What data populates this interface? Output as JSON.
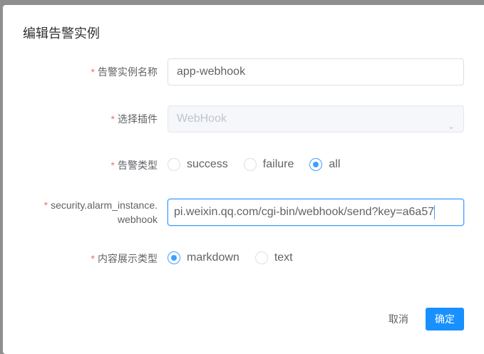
{
  "dialog": {
    "title": "编辑告警实例"
  },
  "form": {
    "required_mark": "*",
    "name": {
      "label": "告警实例名称",
      "value": "app-webhook"
    },
    "plugin": {
      "label": "选择插件",
      "value": "WebHook"
    },
    "alert_type": {
      "label": "告警类型",
      "options": [
        "success",
        "failure",
        "all"
      ],
      "selected": "all"
    },
    "webhook": {
      "label_line1": "security.alarm_instance.",
      "label_line2": "webhook",
      "value": "pi.weixin.qq.com/cgi-bin/webhook/send?key=a6a57"
    },
    "content_type": {
      "label": "内容展示类型",
      "options": [
        "markdown",
        "text"
      ],
      "selected": "markdown"
    }
  },
  "footer": {
    "cancel": "取消",
    "confirm": "确定"
  },
  "colors": {
    "primary": "#1890ff",
    "required": "#f56c6c"
  }
}
